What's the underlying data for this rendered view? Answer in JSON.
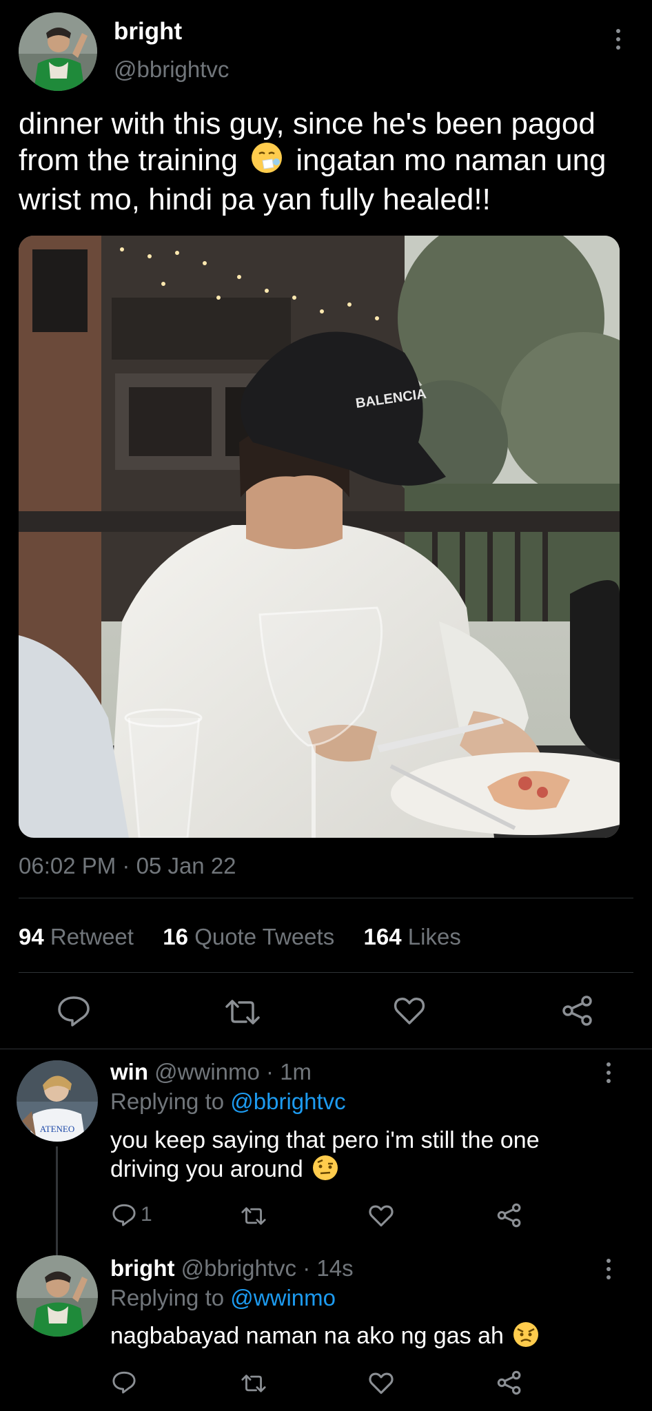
{
  "main_tweet": {
    "display_name": "bright",
    "handle": "@bbrightvc",
    "text_line1": "dinner with this guy, since he's been pagod",
    "text_line2a": "from the training",
    "text_line2b": "ingatan mo naman ung",
    "text_line3": "wrist mo, hindi pa yan fully healed!!",
    "photo_cap_text": "BALENCIA",
    "timestamp": "06:02 PM · 05 Jan 22",
    "stats": {
      "retweets_count": "94",
      "retweets_label": "Retweet",
      "quotes_count": "16",
      "quotes_label": "Quote Tweets",
      "likes_count": "164",
      "likes_label": "Likes"
    }
  },
  "replies": [
    {
      "display_name": "win",
      "meta": "@wwinmo · 1m",
      "replying_label": "Replying to",
      "replying_to": "@bbrightvc",
      "text_line1": "you keep saying that pero i'm still the one",
      "text_line2": "driving you around",
      "avatar_text": "ATENEO",
      "reply_count": "1"
    },
    {
      "display_name": "bright",
      "meta": "@bbrightvc · 14s",
      "replying_label": "Replying to",
      "replying_to": "@wwinmo",
      "text_line1": "nagbabayad naman na ako ng gas ah",
      "reply_count": ""
    }
  ],
  "colors": {
    "background": "#000000",
    "text": "#e7e9ea",
    "muted": "#71767b",
    "link": "#1d9bf0",
    "divider": "#2f3336"
  },
  "icons": [
    "reply-icon",
    "retweet-icon",
    "like-icon",
    "share-icon",
    "more-icon"
  ]
}
